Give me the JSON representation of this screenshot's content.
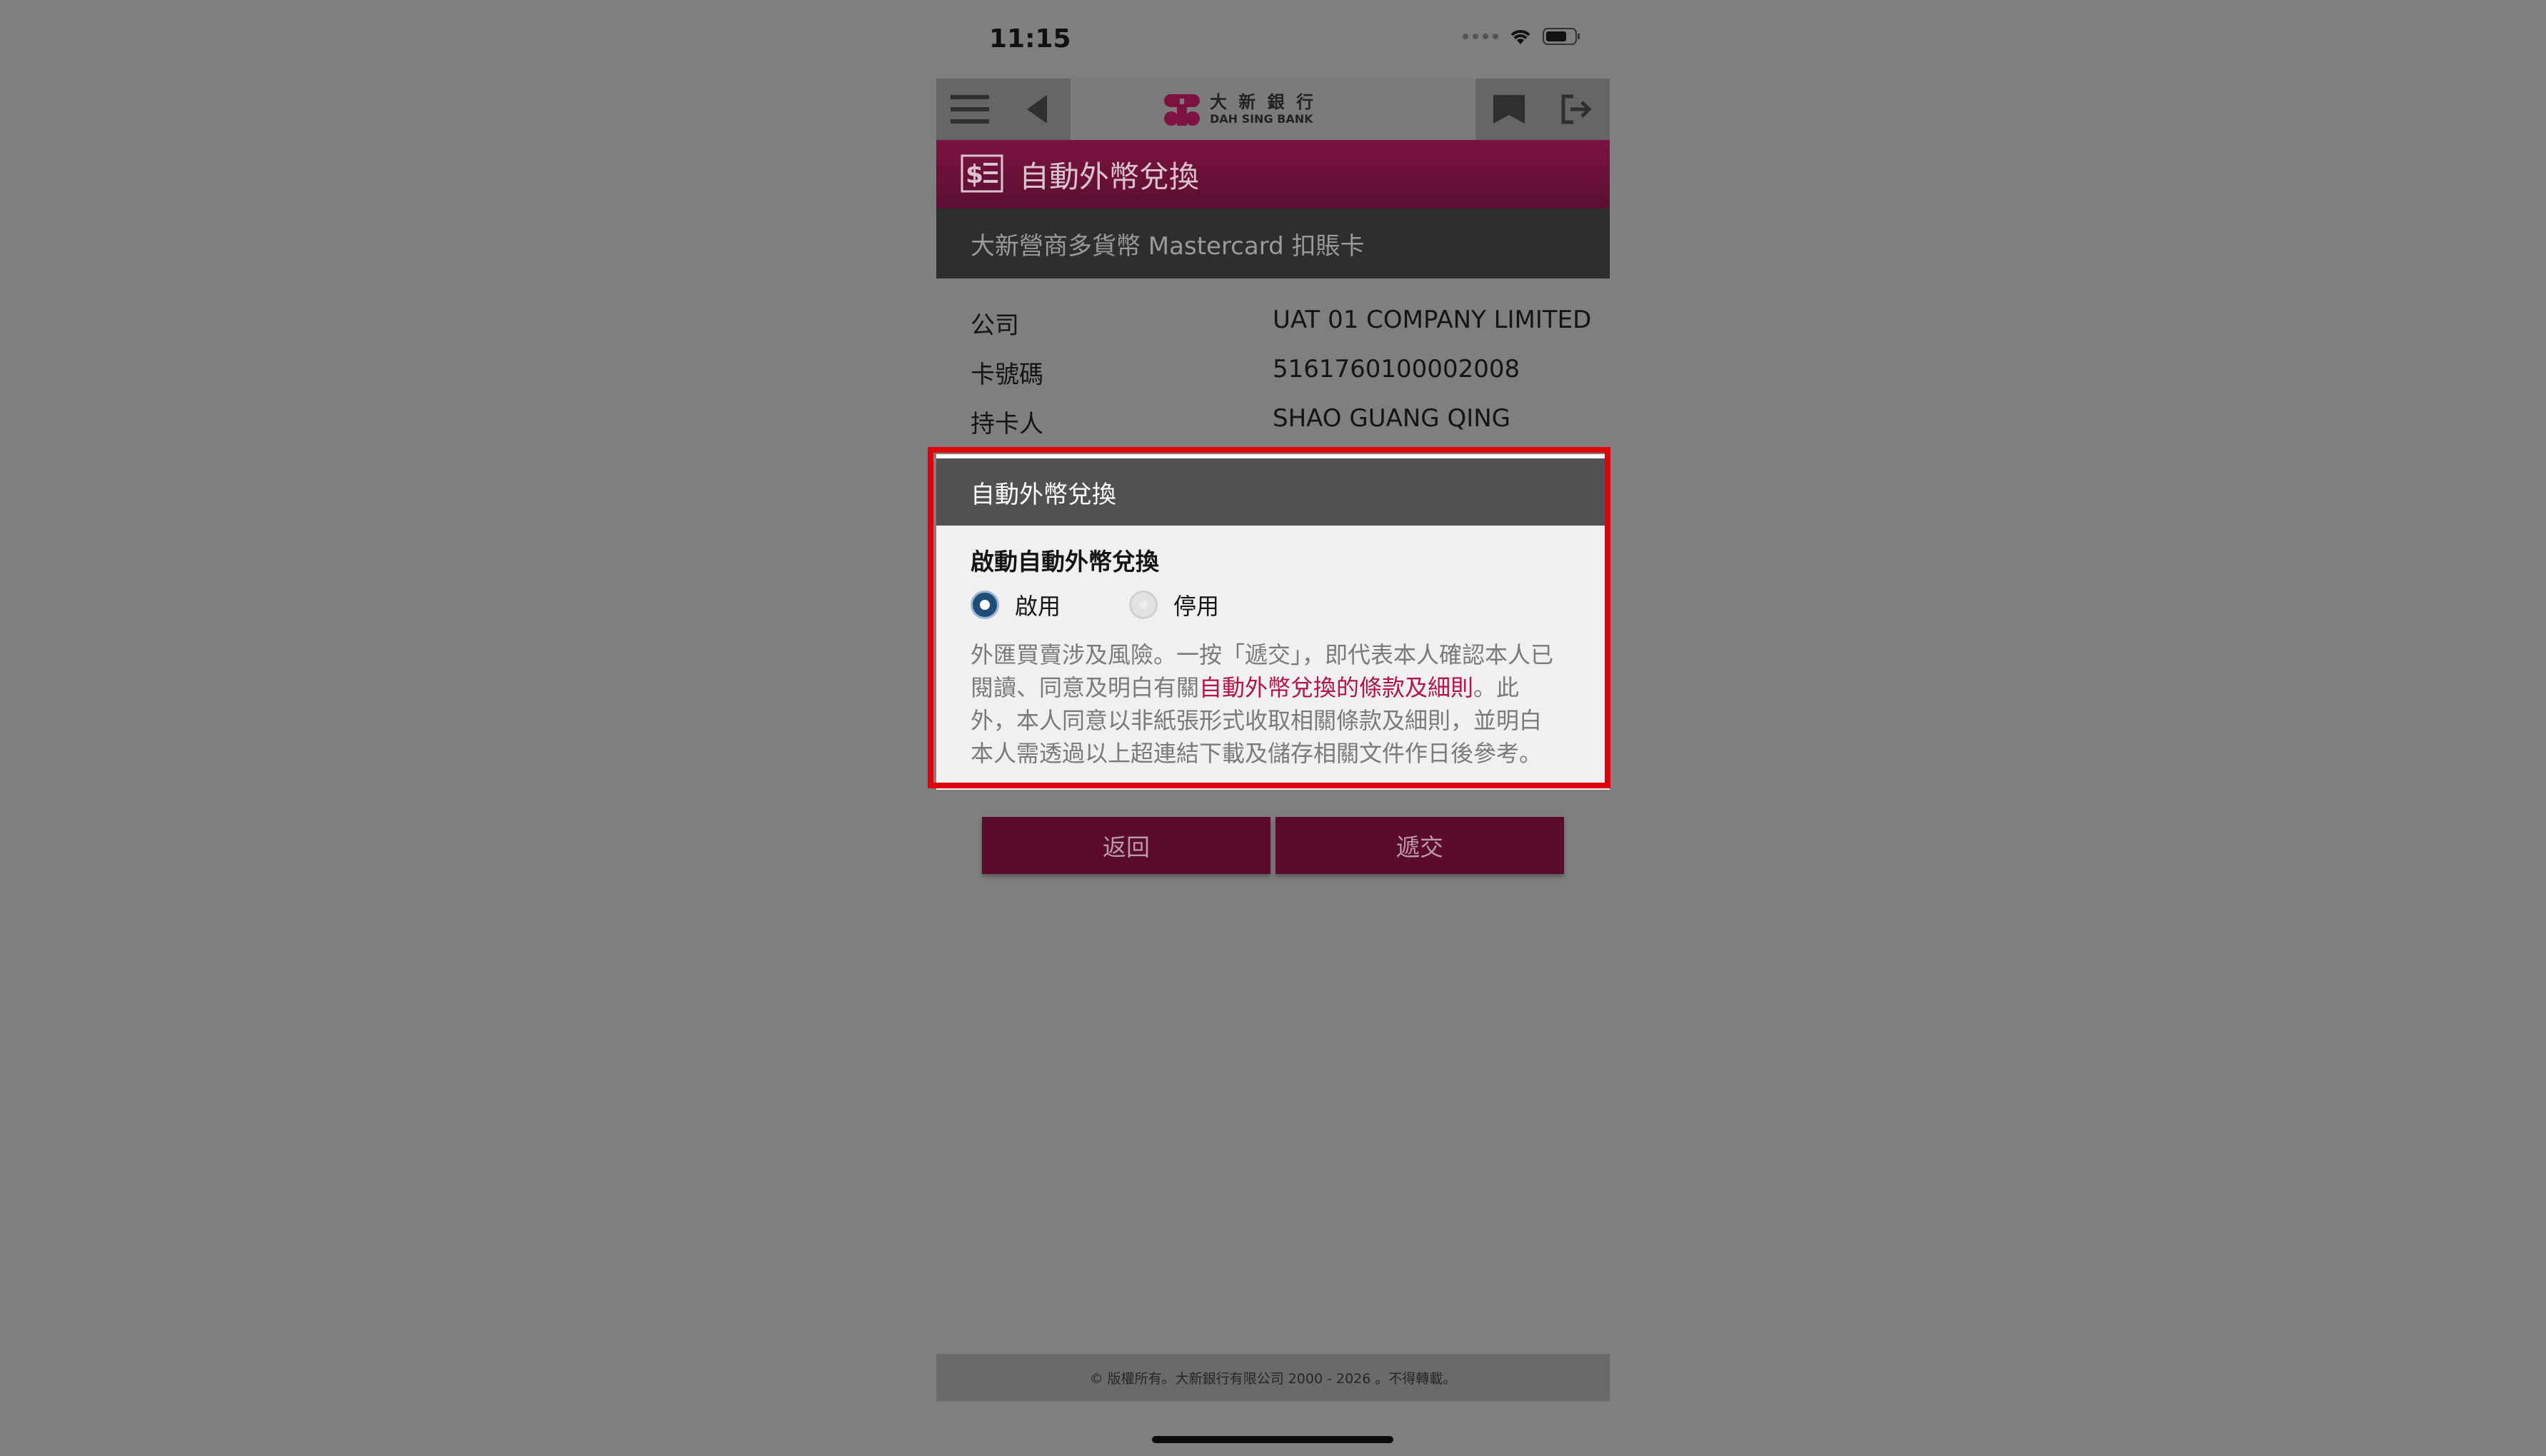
{
  "status_bar": {
    "time": "11:15"
  },
  "navbar": {
    "logo_cn": "大 新 銀 行",
    "logo_en": "DAH SING BANK"
  },
  "titlebar": {
    "title": "自動外幣兌換"
  },
  "card": {
    "name": "大新營商多貨幣 Mastercard 扣賬卡"
  },
  "info": [
    {
      "label": "公司",
      "value": "UAT 01 COMPANY LIMITED"
    },
    {
      "label": "卡號碼",
      "value": "5161760100002008"
    },
    {
      "label": "持卡人",
      "value": "SHAO GUANG QING"
    }
  ],
  "dialog": {
    "header": "自動外幣兌換",
    "subtitle": "啟動自動外幣兌換",
    "options": [
      {
        "label": "啟用",
        "selected": true
      },
      {
        "label": "停用",
        "selected": false
      }
    ],
    "terms_before": "外匯買賣涉及風險。一按「遞交」，即代表本人確認本人已閱讀、同意及明白有關",
    "terms_link": "自動外幣兌換的條款及細則",
    "terms_after": "。此外，本人同意以非紙張形式收取相關條款及細則，並明白本人需透過以上超連結下載及儲存相關文件作日後參考。"
  },
  "buttons": {
    "back": "返回",
    "submit": "遞交"
  },
  "footer": {
    "text": "© 版權所有。大新銀行有限公司 2000 - 2026 。不得轉載。"
  },
  "colors": {
    "brand": "#7d1241",
    "button": "#5b0b2c",
    "link": "#b1134d",
    "highlight": "#e0000b"
  }
}
